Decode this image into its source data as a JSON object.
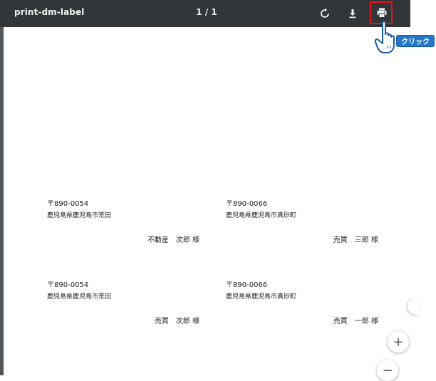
{
  "toolbar": {
    "title": "print-dm-label",
    "page_indicator": "1 / 1"
  },
  "labels": [
    {
      "postal": "〒890-0054",
      "address": "鹿児島県鹿児島市荒田",
      "recipient": "不動産　次郎 様"
    },
    {
      "postal": "〒890-0066",
      "address": "鹿児島県鹿児島市真砂町",
      "recipient": "売買　三郎 様"
    },
    {
      "postal": "〒890-0054",
      "address": "鹿児島県鹿児島市荒田",
      "recipient": "売買　次郎 様"
    },
    {
      "postal": "〒890-0066",
      "address": "鹿児島県鹿児島市真砂町",
      "recipient": "売買　一郎 様"
    }
  ],
  "zoom": {
    "in_label": "+",
    "out_label": "−"
  },
  "annotation": {
    "click_label": "クリック"
  },
  "icons": {
    "rotate": "rotate-icon",
    "download": "download-icon",
    "print": "print-icon",
    "pointer": "hand-pointer-icon"
  },
  "colors": {
    "toolbar_bg": "#323639",
    "viewer_bg": "#525659",
    "highlight": "#e0141e",
    "badge": "#2678c9"
  }
}
